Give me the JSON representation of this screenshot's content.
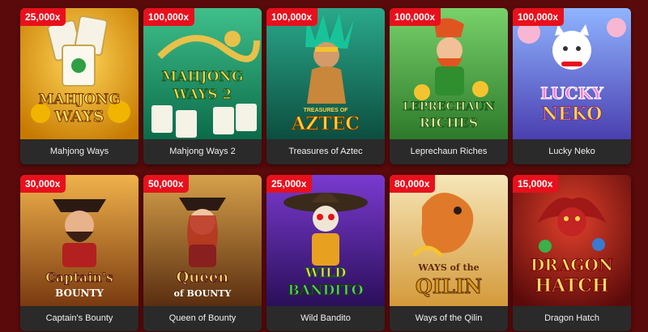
{
  "games": [
    {
      "title": "Mahjong Ways",
      "multiplier": "25,000x",
      "logo": [
        "MAHJONG",
        "WAYS"
      ]
    },
    {
      "title": "Mahjong Ways 2",
      "multiplier": "100,000x",
      "logo": [
        "MAHJONG",
        "WAYS 2"
      ]
    },
    {
      "title": "Treasures of Aztec",
      "multiplier": "100,000x",
      "logo": [
        "TREASURES OF",
        "AZTEC"
      ]
    },
    {
      "title": "Leprechaun Riches",
      "multiplier": "100,000x",
      "logo": [
        "LEPRECHAUN",
        "RICHES"
      ]
    },
    {
      "title": "Lucky Neko",
      "multiplier": "100,000x",
      "logo": [
        "LUCKY",
        "NEKO"
      ]
    },
    {
      "title": "Captain's Bounty",
      "multiplier": "30,000x",
      "logo": [
        "Captain's",
        "BOUNTY"
      ]
    },
    {
      "title": "Queen of Bounty",
      "multiplier": "50,000x",
      "logo": [
        "Queen",
        "of BOUNTY"
      ]
    },
    {
      "title": "Wild Bandito",
      "multiplier": "25,000x",
      "logo": [
        "WILD",
        "BANDITO"
      ]
    },
    {
      "title": "Ways of the Qilin",
      "multiplier": "80,000x",
      "logo": [
        "WAYS of the",
        "QILIN"
      ]
    },
    {
      "title": "Dragon Hatch",
      "multiplier": "15,000x",
      "logo": [
        "DRAGON",
        "HATCH"
      ]
    }
  ],
  "colors": {
    "page_background": "#5a0a0a",
    "badge": "#e8101c",
    "title_bar": "#2a2a2a"
  }
}
